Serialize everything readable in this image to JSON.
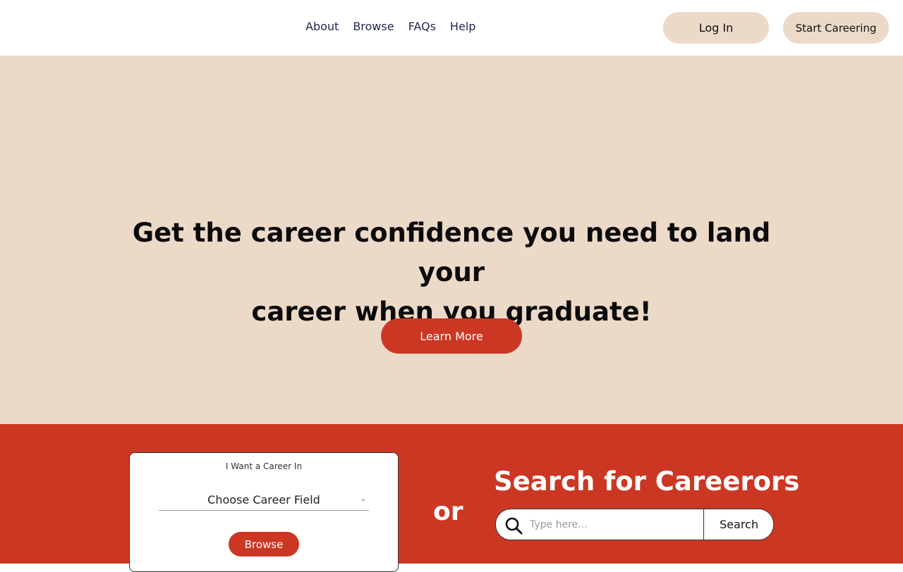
{
  "nav": {
    "items": [
      {
        "label": "About"
      },
      {
        "label": "Browse"
      },
      {
        "label": "FAQs"
      },
      {
        "label": "Help"
      }
    ]
  },
  "header": {
    "login_label": "Log In",
    "start_label": "Start Careering"
  },
  "hero": {
    "title_line1": "Get the career confidence you need to land your",
    "title_line2": "career when you graduate!",
    "cta_label": "Learn More"
  },
  "career_picker": {
    "label": "I Want a Career In",
    "select_value": "Choose Career Field",
    "browse_label": "Browse"
  },
  "divider_text": "or",
  "search": {
    "title": "Search for Careerors",
    "placeholder": "Type here...",
    "button_label": "Search"
  },
  "colors": {
    "accent": "#cb3723",
    "hero_bg": "#ecdac8",
    "nav_text": "#1d2a4d"
  }
}
